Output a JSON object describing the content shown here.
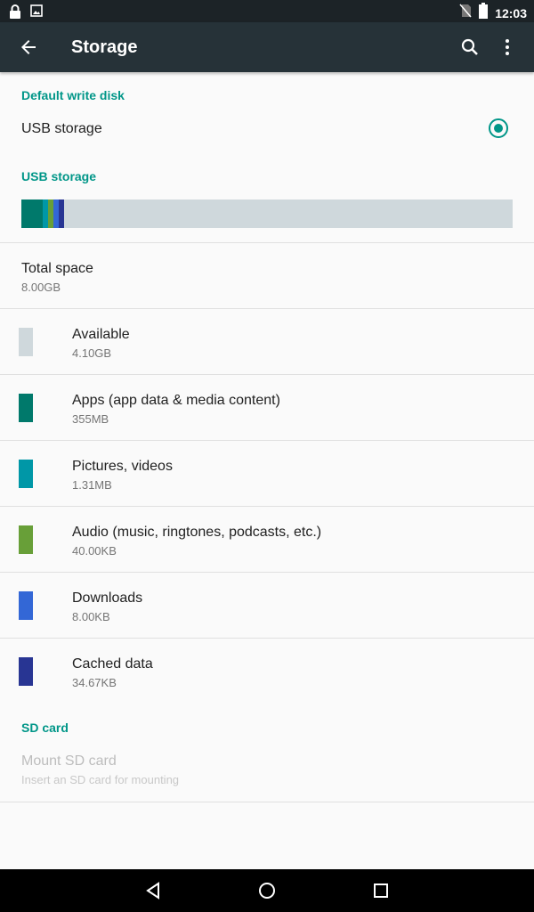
{
  "status_bar": {
    "time": "12:03",
    "left_icons": [
      "lock-icon",
      "image-icon"
    ],
    "right_icons": [
      "no-sim-icon",
      "battery-icon"
    ]
  },
  "app_bar": {
    "title": "Storage",
    "icons": [
      "back-arrow-icon",
      "search-icon",
      "more-vert-icon"
    ]
  },
  "default_write_disk": {
    "header": "Default write disk",
    "option_label": "USB storage",
    "selected": true
  },
  "usb_storage": {
    "header": "USB storage",
    "total": {
      "title": "Total space",
      "value": "8.00GB"
    },
    "categories": [
      {
        "title": "Available",
        "value": "4.10GB",
        "color": "#cfd8dc"
      },
      {
        "title": "Apps (app data & media content)",
        "value": "355MB",
        "color": "#00796b"
      },
      {
        "title": "Pictures, videos",
        "value": "1.31MB",
        "color": "#0097a7"
      },
      {
        "title": "Audio (music, ringtones, podcasts, etc.)",
        "value": "40.00KB",
        "color": "#689f38"
      },
      {
        "title": "Downloads",
        "value": "8.00KB",
        "color": "#3367d6"
      },
      {
        "title": "Cached data",
        "value": "34.67KB",
        "color": "#283593"
      }
    ],
    "usage_bar_fractions": [
      {
        "name": "apps",
        "fraction": 0.043,
        "color": "#00796b"
      },
      {
        "name": "pictures",
        "fraction": 0.011,
        "color": "#0097a7"
      },
      {
        "name": "audio",
        "fraction": 0.011,
        "color": "#689f38"
      },
      {
        "name": "downloads",
        "fraction": 0.011,
        "color": "#3367d6"
      },
      {
        "name": "cached",
        "fraction": 0.011,
        "color": "#283593"
      }
    ]
  },
  "sd_card": {
    "header": "SD card",
    "mount_title": "Mount SD card",
    "mount_subtitle": "Insert an SD card for mounting",
    "enabled": false
  },
  "nav_bar": {
    "icons": [
      "back-triangle-icon",
      "home-circle-icon",
      "recents-square-icon"
    ]
  }
}
